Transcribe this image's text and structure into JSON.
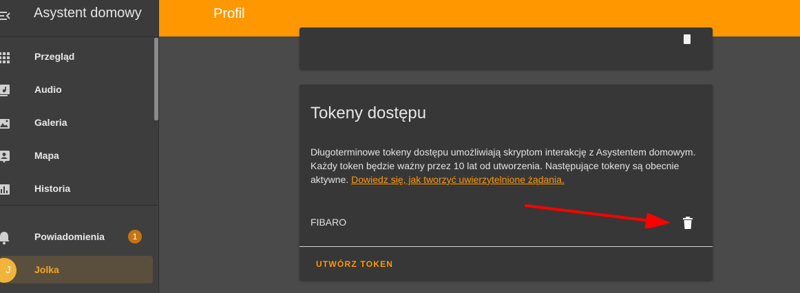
{
  "sidebar": {
    "title": "Asystent domowy",
    "items": [
      {
        "label": "Przegląd",
        "icon": "dashboard-grid-icon"
      },
      {
        "label": "Audio",
        "icon": "music-icon"
      },
      {
        "label": "Galeria",
        "icon": "gallery-icon"
      },
      {
        "label": "Mapa",
        "icon": "map-person-icon"
      },
      {
        "label": "Historia",
        "icon": "history-chart-icon"
      }
    ],
    "notifications": {
      "label": "Powiadomienia",
      "count": "1",
      "icon": "bell-icon"
    },
    "user": {
      "initial": "J",
      "label": "Jolka"
    }
  },
  "header": {
    "title": "Profil"
  },
  "tokens_card": {
    "title": "Tokeny dostępu",
    "description": "Długoterminowe tokeny dostępu umożliwiają skryptom interakcję z Asystentem domowym. Każdy token będzie ważny przez 10 lat od utworzenia. Następujące tokeny są obecnie aktywne.",
    "link_text": "Dowiedz się, jak tworzyć uwierzytelnione żądania.",
    "tokens": [
      {
        "name": "FIBARO"
      }
    ],
    "create_label": "UTWÓRZ TOKEN"
  },
  "colors": {
    "accent": "#ff9800",
    "badge": "#c7730f",
    "annotation_arrow": "#ff0000"
  }
}
